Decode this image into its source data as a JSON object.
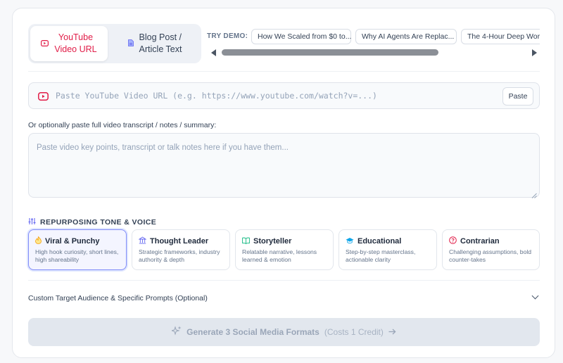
{
  "input_tabs": [
    {
      "label_line1": "YouTube",
      "label_line2": "Video URL",
      "icon": "youtube-icon",
      "active": true
    },
    {
      "label_line1": "Blog Post /",
      "label_line2": "Article Text",
      "icon": "document-icon",
      "active": false
    }
  ],
  "demo": {
    "label": "TRY DEMO:",
    "chips": [
      "How We Scaled from $0 to...",
      "Why AI Agents Are Replac...",
      "The 4-Hour Deep Wor"
    ]
  },
  "url_input": {
    "placeholder": "Paste YouTube Video URL (e.g. https://www.youtube.com/watch?v=...)",
    "value": "",
    "paste_label": "Paste"
  },
  "notes": {
    "label": "Or optionally paste full video transcript / notes / summary:",
    "placeholder": "Paste video key points, transcript or talk notes here if you have them..."
  },
  "tone": {
    "title": "REPURPOSING TONE & VOICE",
    "options": [
      {
        "name": "Viral & Punchy",
        "desc": "High hook curiosity, short lines, high shareability",
        "icon": "fire-icon",
        "selected": true
      },
      {
        "name": "Thought Leader",
        "desc": "Strategic frameworks, industry authority & depth",
        "icon": "building-icon",
        "selected": false
      },
      {
        "name": "Storyteller",
        "desc": "Relatable narrative, lessons learned & emotion",
        "icon": "book-icon",
        "selected": false
      },
      {
        "name": "Educational",
        "desc": "Step-by-step masterclass, actionable clarity",
        "icon": "graduation-cap-icon",
        "selected": false
      },
      {
        "name": "Contrarian",
        "desc": "Challenging assumptions, bold counter-takes",
        "icon": "question-circle-icon",
        "selected": false
      }
    ]
  },
  "custom": {
    "label": "Custom Target Audience & Specific Prompts (Optional)"
  },
  "generate": {
    "label": "Generate 3 Social Media Formats",
    "cost": "(Costs 1 Credit)",
    "disabled": true
  },
  "colors": {
    "accent": "#e11d48",
    "selected_border": "#818cf8",
    "selected_bg": "#f4f5ff",
    "button_disabled_bg": "#e2e7ee"
  }
}
